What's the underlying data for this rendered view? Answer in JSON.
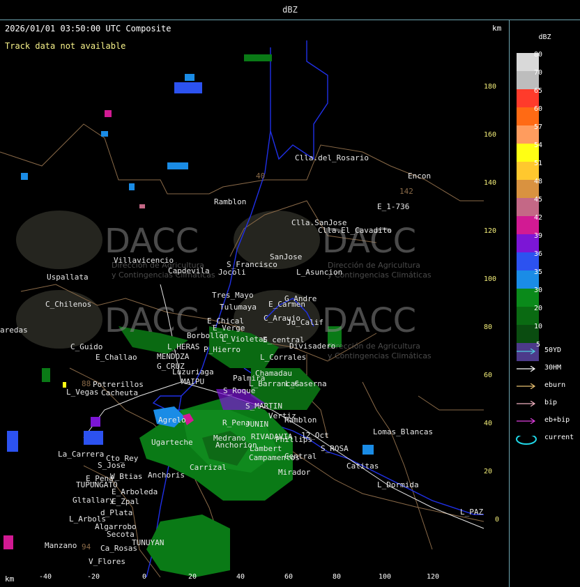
{
  "window": {
    "title": "dBZ"
  },
  "map": {
    "timestamp": "2026/01/01 03:50:00 UTC Composite",
    "status": "Track data not available",
    "unit_top": "km",
    "unit_bottom": "km",
    "watermark": {
      "logo": "DACC",
      "line1": "Dirección de Agricultura",
      "line2": "y Contingencias Climáticas"
    },
    "y_ticks": [
      "180",
      "160",
      "140",
      "120",
      "100",
      "80",
      "60",
      "40",
      "20",
      "0"
    ],
    "x_ticks": [
      "-40",
      "-20",
      "0",
      "20",
      "40",
      "60",
      "80",
      "100",
      "120"
    ],
    "places": [
      "Clla.del_Rosario",
      "Encon",
      "142",
      "E_1-736",
      "Ramblon",
      "40",
      "Clla.SanJose",
      "Clla.El_Cavadito",
      "Villavicencio",
      "Capdevila",
      "Jocoli",
      "S_Francisco",
      "SanJose",
      "L_Asuncion",
      "Uspallata",
      "C_Chilenos",
      "Tres_Mayo",
      "Tulumaya",
      "G_Andre",
      "E_Carmen",
      "E_Chical",
      "E_Verge",
      "C_Araujo",
      "Ju_Calif",
      "aredas",
      "Borbollon",
      "L_Violetas",
      "E_central",
      "Divisadero",
      "C_Guido",
      "L_HERAS",
      "P_Hierro",
      "E_Challao",
      "MENDOZA",
      "L_Corrales",
      "G_CRUZ",
      "Luzuriaga",
      "Chamadau",
      "Potrerillos",
      "MAIPU",
      "L_Vegas",
      "Cacheuta",
      "S_Roque",
      "Palmira",
      "L_Barrancas",
      "L_Caserna",
      "88",
      "S_MARTIN",
      "Agrelo",
      "Vertiz",
      "Ramblon",
      "R_Pena",
      "JUNIN",
      "Lomas_Blancas",
      "RIVADAVIA",
      "Phillips",
      "12_Oct",
      "Ugarteche",
      "Medrano",
      "Anchorion",
      "S_ROSA",
      "La_Carrera",
      "Cto_Rey",
      "S_Jose",
      "Lambert",
      "Campamentos",
      "Central",
      "Catitas",
      "Carrizal",
      "Mirador",
      "Anchoris",
      "E_Pena",
      "TUPUNGATO",
      "W_Btias",
      "L_Dormida",
      "E_Arboleda",
      "Gltallary",
      "E_Zpal",
      "L_PAZ",
      "d_Plata",
      "L_Arbols",
      "Algarrobo",
      "Secota",
      "Manzano",
      "94",
      "Ca_Rosas",
      "TUNUYAN",
      "V_Flores"
    ]
  },
  "legend": {
    "title": "dBZ",
    "colorbar": [
      {
        "label": "80",
        "color": "#d9d9d9"
      },
      {
        "label": "70",
        "color": "#bdbdbd"
      },
      {
        "label": "65",
        "color": "#ff3b2b"
      },
      {
        "label": "60",
        "color": "#ff6a14"
      },
      {
        "label": "57",
        "color": "#ff9c5e"
      },
      {
        "label": "54",
        "color": "#ffff14"
      },
      {
        "label": "51",
        "color": "#ffc82e"
      },
      {
        "label": "48",
        "color": "#d99240"
      },
      {
        "label": "45",
        "color": "#c46886"
      },
      {
        "label": "42",
        "color": "#d21a93"
      },
      {
        "label": "39",
        "color": "#7c16d6"
      },
      {
        "label": "36",
        "color": "#2c52f0"
      },
      {
        "label": "35",
        "color": "#1a8ce6"
      },
      {
        "label": "30",
        "color": "#0a8a1a"
      },
      {
        "label": "20",
        "color": "#0a6a12"
      },
      {
        "label": "10",
        "color": "#0a4c10"
      },
      {
        "label": "5",
        "color": "#4c3a8a"
      }
    ],
    "tracks": [
      {
        "label": "50YD",
        "color": "#4fd0e0"
      },
      {
        "label": "30HM",
        "color": "#ffffff"
      },
      {
        "label": "eburn",
        "color": "#e8c070"
      },
      {
        "label": "bip",
        "color": "#f0b0c0"
      },
      {
        "label": "eb+bip",
        "color": "#e040e0"
      },
      {
        "label": "current",
        "color": "#20d8e8"
      }
    ]
  }
}
